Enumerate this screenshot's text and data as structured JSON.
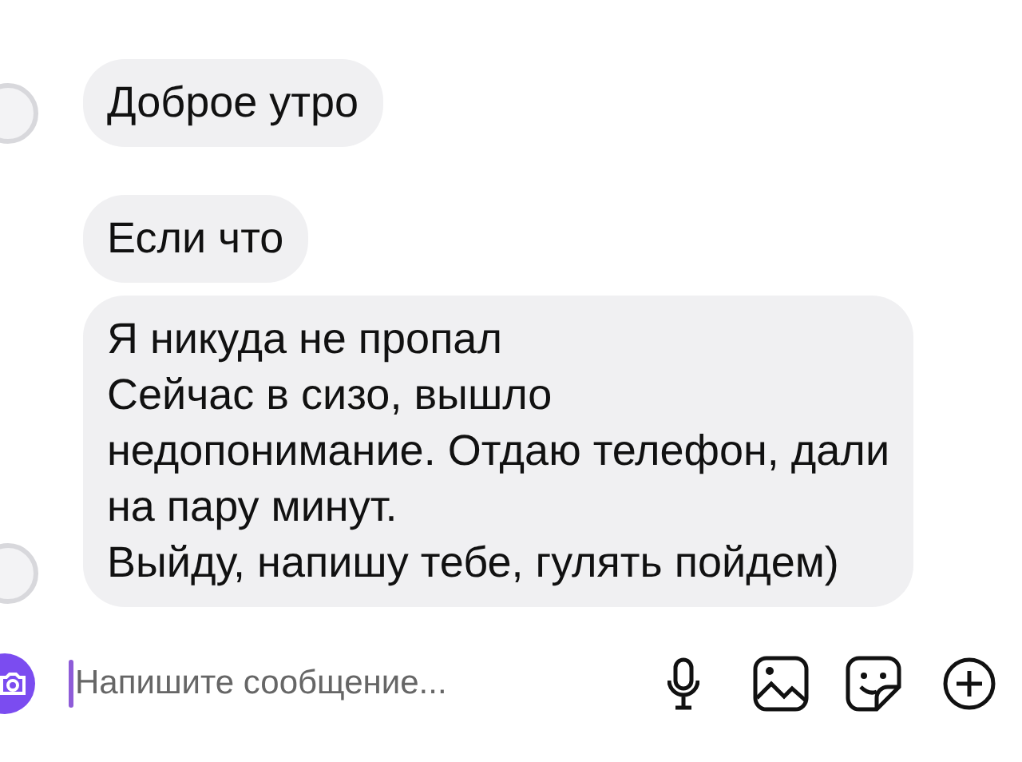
{
  "messages": [
    {
      "avatar": true,
      "lines": [
        "Доброе утро"
      ]
    },
    {
      "avatar": false,
      "lines": [
        "Если что"
      ]
    },
    {
      "avatar": true,
      "lines": [
        "Я никуда не пропал",
        "Сейчас в сизо, вышло",
        "недопонимание. Отдаю телефон, дали",
        "на пару минут.",
        "Выйду, напишу тебе, гулять пойдем)"
      ]
    }
  ],
  "composer": {
    "placeholder": "Напишите сообщение..."
  }
}
